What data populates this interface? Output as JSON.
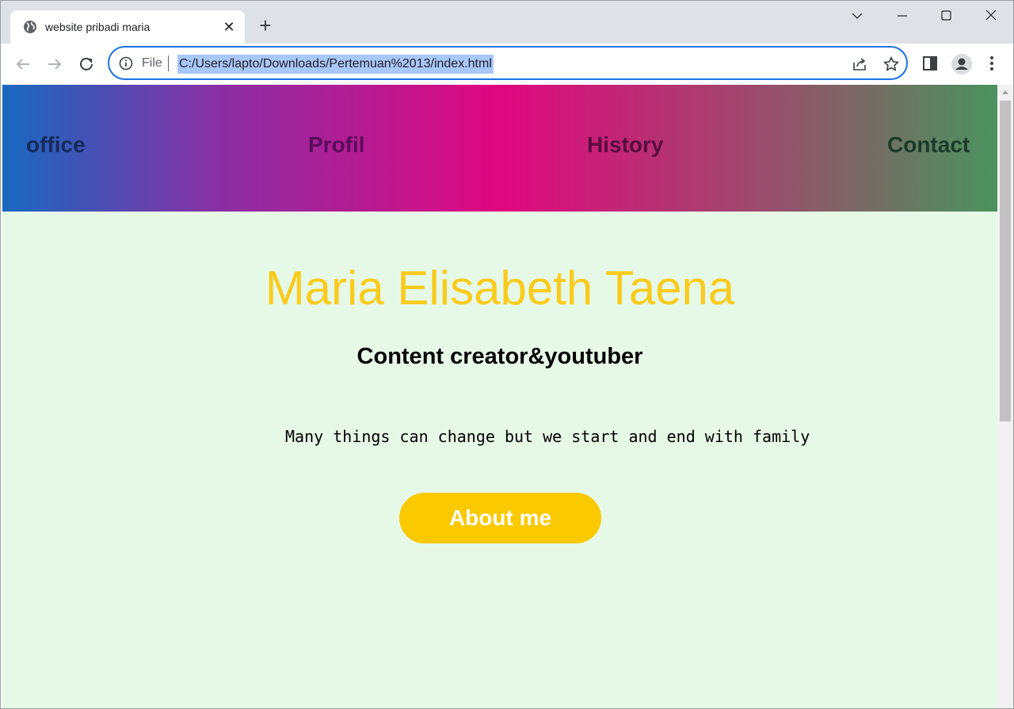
{
  "tab": {
    "title": "website pribadi maria",
    "favicon": "globe-icon"
  },
  "toolbar": {
    "scheme_label": "File",
    "url": "C:/Users/lapto/Downloads/Pertemuan%2013/index.html"
  },
  "page": {
    "nav": [
      "office",
      "Profil",
      "History",
      "Contact"
    ],
    "name": "Maria Elisabeth Taena",
    "subtitle": "Content creator&youtuber",
    "quote": "Many things can change but we start and end with family",
    "button": "About me"
  },
  "colors": {
    "gradient": [
      "#1868c0",
      "#8a2fa3",
      "#e0077f",
      "#a8406e",
      "#4b925e"
    ],
    "background": "#e6f9e6",
    "name": "#f9cb1e",
    "button": "#fbc900",
    "omnibox_focus": "#1a73e8"
  }
}
